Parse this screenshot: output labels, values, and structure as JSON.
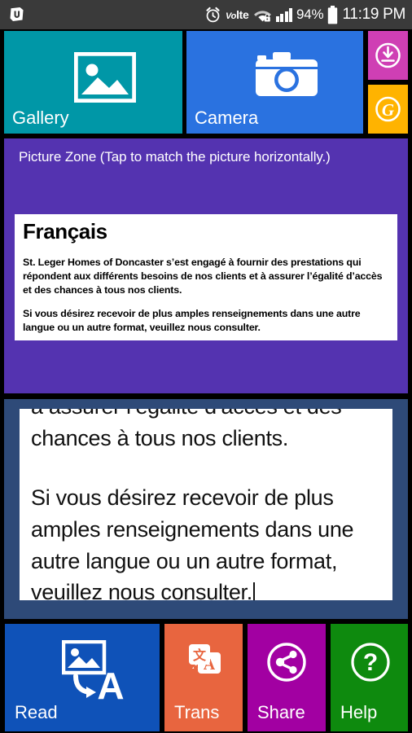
{
  "status_bar": {
    "left_icon": "app-notification-icon",
    "alarm_icon": "alarm-clock-icon",
    "volte_prefix": "Vo",
    "volte_suffix": "lte",
    "wifi_icon": "wifi-secured-icon",
    "signal_icon": "signal-bars-icon",
    "battery_percent": "94%",
    "battery_icon": "battery-full-icon",
    "time": "11:19 PM"
  },
  "top_tiles": {
    "gallery": {
      "label": "Gallery",
      "icon": "gallery-image-icon",
      "color": "#0097a7"
    },
    "camera": {
      "label": "Camera",
      "icon": "camera-icon",
      "color": "#2a72e0"
    },
    "download": {
      "label": "",
      "icon": "download-circle-icon",
      "color": "#cf3fb4"
    },
    "g_button": {
      "label": "",
      "icon": "g-circle-icon",
      "color": "#ffb300"
    }
  },
  "picture_zone": {
    "title": "Picture Zone (Tap to match the picture horizontally.)",
    "background_color": "#5433b0",
    "document": {
      "heading": "Français",
      "paragraph1": "St. Leger Homes of Doncaster s’est engagé à fournir des prestations qui répondent aux différents besoins de nos clients et à assurer l’égalité d’accès et des chances à tous nos clients.",
      "paragraph2": "Si vous désirez recevoir de plus amples renseignements dans une autre langue ou un autre format, veuillez nous consulter."
    }
  },
  "text_zone": {
    "background_color": "#2e4a78",
    "line_clipped": "à assurer l’égalité d’accès et des",
    "line2": "chances à tous nos clients.",
    "paragraph2": "Si vous désirez recevoir de plus amples renseignements dans une autre langue ou un autre format, veuillez nous consulter."
  },
  "bottom_tiles": {
    "read": {
      "label": "Read",
      "icon": "image-to-text-icon",
      "color": "#0f52b8"
    },
    "trans": {
      "label": "Trans",
      "icon": "translate-icon",
      "color": "#e8653f"
    },
    "share": {
      "label": "Share",
      "icon": "share-icon",
      "color": "#a200a2"
    },
    "help": {
      "label": "Help",
      "icon": "question-mark-icon",
      "color": "#0e8a0e"
    }
  }
}
